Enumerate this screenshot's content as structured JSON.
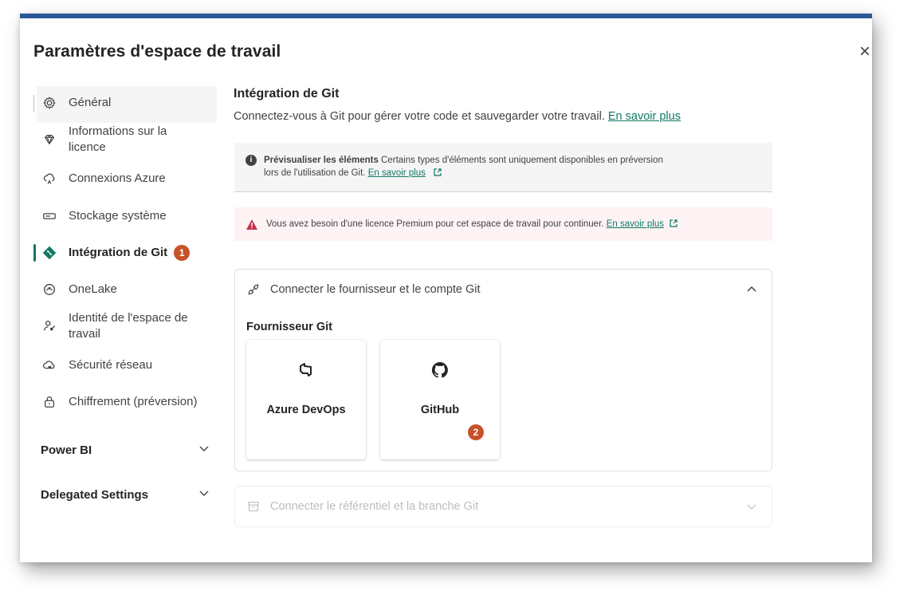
{
  "dialog": {
    "title": "Paramètres d'espace de travail",
    "close_label": "×"
  },
  "sidebar": {
    "items": [
      {
        "label": "Général",
        "icon": "gear-icon"
      },
      {
        "label": "Informations sur la licence",
        "icon": "diamond-icon"
      },
      {
        "label": "Connexions Azure",
        "icon": "cloud-connect-icon"
      },
      {
        "label": "Stockage système",
        "icon": "storage-icon"
      },
      {
        "label": "Intégration de Git",
        "icon": "git-icon",
        "badge": "1"
      },
      {
        "label": "OneLake",
        "icon": "onelake-icon"
      },
      {
        "label": "Identité de l'espace de travail",
        "icon": "person-key-icon"
      },
      {
        "label": "Sécurité réseau",
        "icon": "cloud-lock-icon"
      },
      {
        "label": "Chiffrement (préversion)",
        "icon": "lock-icon"
      }
    ],
    "sections": [
      {
        "label": "Power BI"
      },
      {
        "label": "Delegated Settings"
      }
    ]
  },
  "main": {
    "title": "Intégration de Git",
    "description": "Connectez-vous à Git pour gérer votre code et sauvegarder votre travail.",
    "learn_more": "En savoir plus",
    "info": {
      "bold": "Prévisualiser les éléments",
      "text_line1": "Certains types d'éléments sont uniquement disponibles en préversion",
      "text_line2": "lors de l'utilisation de Git.",
      "link": "En savoir plus"
    },
    "warning": {
      "text": "Vous avez besoin d'une licence Premium pour cet espace de travail pour continuer.",
      "link": "En savoir plus"
    },
    "connect_card": {
      "title": "Connecter le fournisseur et le compte Git",
      "provider_label": "Fournisseur Git",
      "providers": [
        {
          "label": "Azure DevOps",
          "icon": "azure-devops-icon"
        },
        {
          "label": "GitHub",
          "icon": "github-icon",
          "badge": "2"
        }
      ]
    },
    "repo_card": {
      "title": "Connecter le référentiel et la branche Git"
    }
  },
  "colors": {
    "accent": "#117865",
    "badge": "#c7522a",
    "top_bar": "#2b5797",
    "warning_bg": "#fdf3f4"
  }
}
